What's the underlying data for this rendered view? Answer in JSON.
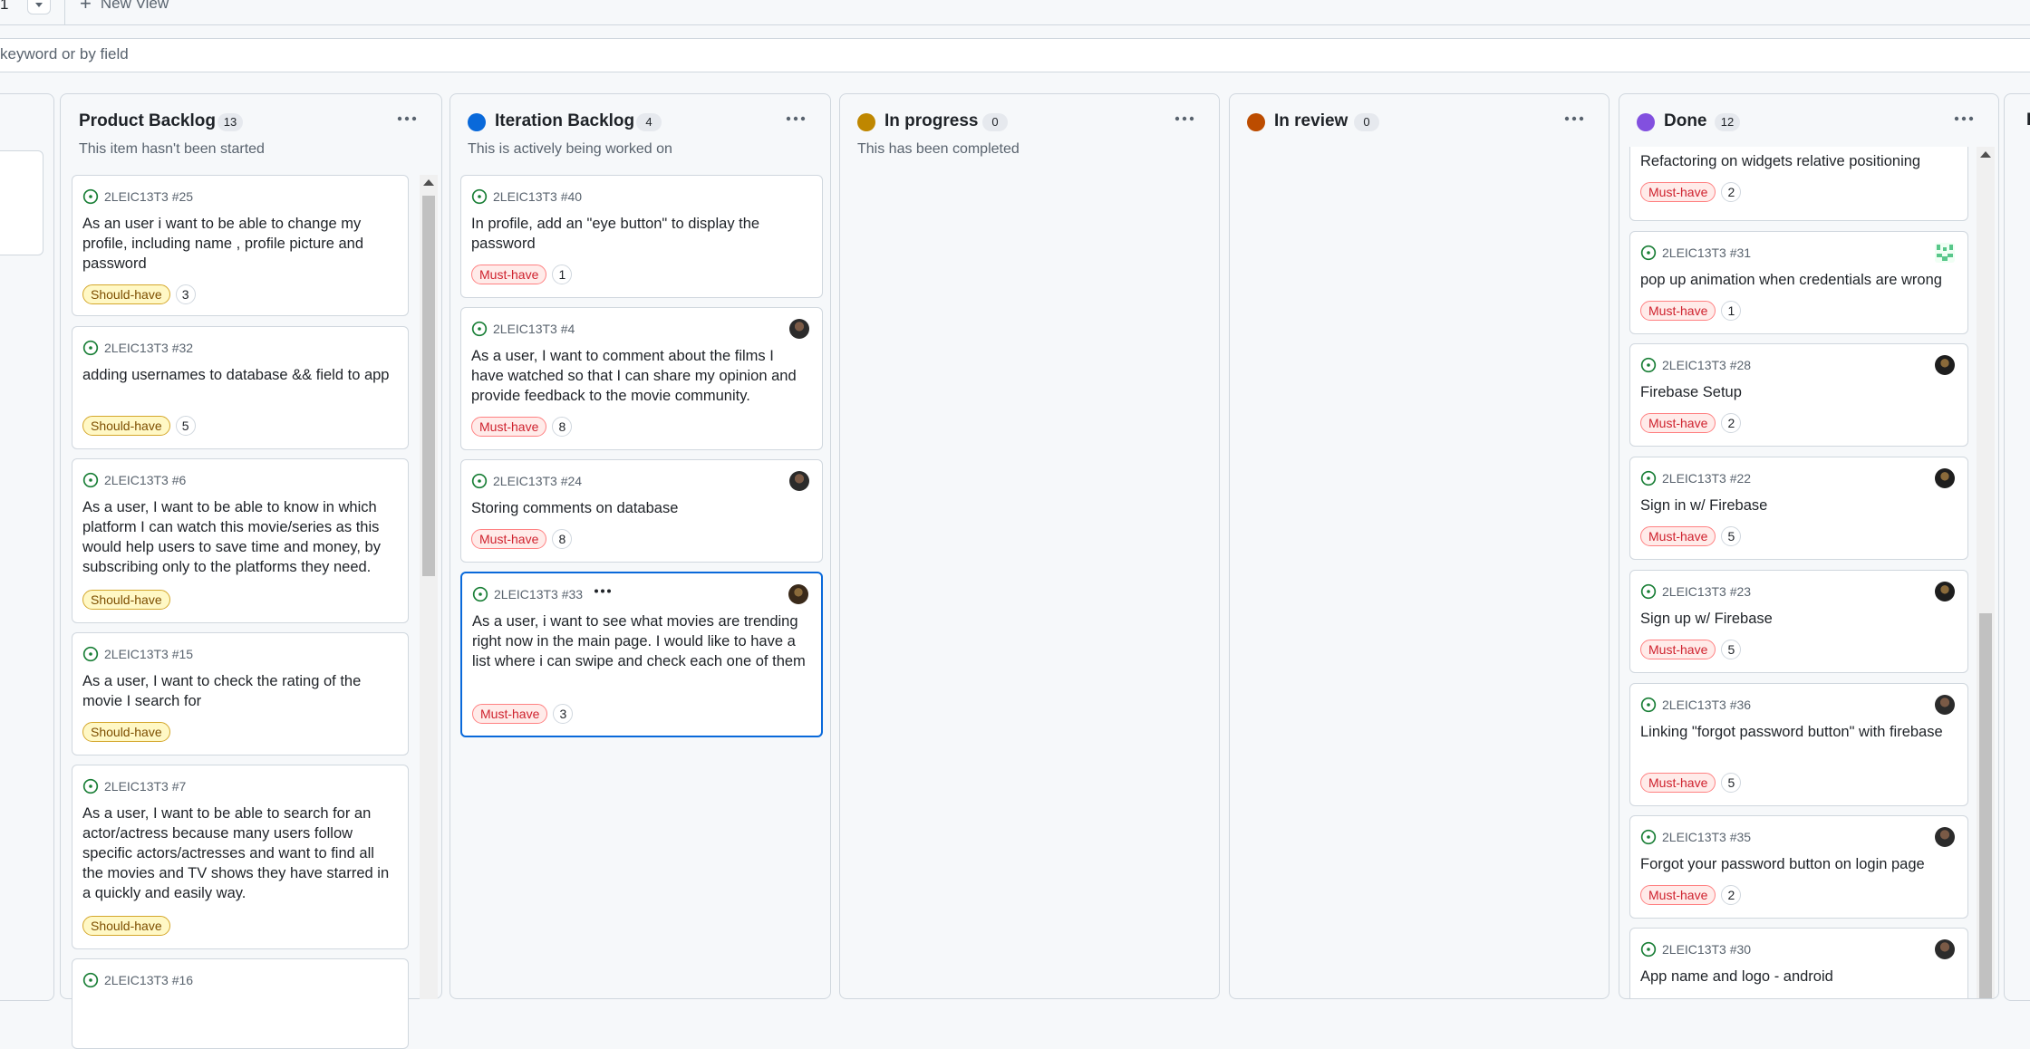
{
  "viewbar": {
    "current_view": "1",
    "new_view_label": "New View"
  },
  "filter": {
    "placeholder": "keyword or by field"
  },
  "board": {
    "offscreen_next_column_initial": "D",
    "columns": [
      {
        "name": "Product Backlog",
        "count": "13",
        "description": "This item hasn't been started",
        "status_color": null,
        "cards": [
          {
            "id": "2LEIC13T3 #25",
            "title": "As an user i want to be able to change my profile, including name , profile picture and password",
            "label": "Should-have",
            "estimate": "3"
          },
          {
            "id": "2LEIC13T3 #32",
            "title": "adding usernames to database && field to app",
            "label": "Should-have",
            "estimate": "5"
          },
          {
            "id": "2LEIC13T3 #6",
            "title": "As a user, I want to be able to know in which platform I can watch this movie/series as this would help users to save time and money, by subscribing only to the platforms they need.",
            "label": "Should-have",
            "estimate": ""
          },
          {
            "id": "2LEIC13T3 #15",
            "title": "As a user, I want to check the rating of the movie I search for",
            "label": "Should-have",
            "estimate": ""
          },
          {
            "id": "2LEIC13T3 #7",
            "title": "As a user, I want to be able to search for an actor/actress because many users follow specific actors/actresses and want to find all the movies and TV shows they have starred in a quickly and easily way.",
            "label": "Should-have",
            "estimate": ""
          },
          {
            "id": "2LEIC13T3 #16",
            "title": "",
            "label": "",
            "estimate": ""
          }
        ]
      },
      {
        "name": "Iteration Backlog",
        "count": "4",
        "description": "This is actively being worked on",
        "status_color": "#0969da",
        "cards": [
          {
            "id": "2LEIC13T3 #40",
            "title": "In profile, add an \"eye button\" to display the password",
            "label": "Must-have",
            "estimate": "1"
          },
          {
            "id": "2LEIC13T3 #4",
            "title": "As a user, I want to comment about the films I have watched so that I can share my opinion and provide feedback to the movie community.",
            "label": "Must-have",
            "estimate": "8"
          },
          {
            "id": "2LEIC13T3 #24",
            "title": "Storing comments on database",
            "label": "Must-have",
            "estimate": "8"
          },
          {
            "id": "2LEIC13T3 #33",
            "title": "As a user, i want to see what movies are trending right now in the main page. I would like to have a list where i can swipe and check each one of them",
            "label": "Must-have",
            "estimate": "3"
          }
        ]
      },
      {
        "name": "In progress",
        "count": "0",
        "description": "This has been completed",
        "status_color": "#bf8700",
        "cards": []
      },
      {
        "name": "In review",
        "count": "0",
        "description": "",
        "status_color": "#bc4c00",
        "cards": []
      },
      {
        "name": "Done",
        "count": "12",
        "description": "",
        "status_color": "#8250df",
        "cards": [
          {
            "id": "",
            "title": "Refactoring on widgets relative positioning",
            "label": "Must-have",
            "estimate": "2"
          },
          {
            "id": "2LEIC13T3 #31",
            "title": "pop up animation when credentials are wrong",
            "label": "Must-have",
            "estimate": "1"
          },
          {
            "id": "2LEIC13T3 #28",
            "title": "Firebase Setup",
            "label": "Must-have",
            "estimate": "2"
          },
          {
            "id": "2LEIC13T3 #22",
            "title": "Sign in w/ Firebase",
            "label": "Must-have",
            "estimate": "5"
          },
          {
            "id": "2LEIC13T3 #23",
            "title": "Sign up w/ Firebase",
            "label": "Must-have",
            "estimate": "5"
          },
          {
            "id": "2LEIC13T3 #36",
            "title": "Linking \"forgot password button\" with firebase",
            "label": "Must-have",
            "estimate": "5"
          },
          {
            "id": "2LEIC13T3 #35",
            "title": "Forgot your password button on login page",
            "label": "Must-have",
            "estimate": "2"
          },
          {
            "id": "2LEIC13T3 #30",
            "title": "App name and logo - android",
            "label": "",
            "estimate": ""
          }
        ]
      }
    ]
  },
  "icons": {
    "issue": "issue-open-icon",
    "more": "kebab-horizontal-icon",
    "plus": "plus-icon",
    "caret": "triangle-down-icon"
  },
  "colors": {
    "issue_open": "#1a7f37",
    "selected_border": "#0969da",
    "must_have": "#cf222e",
    "should_have": "#7d4e00"
  }
}
